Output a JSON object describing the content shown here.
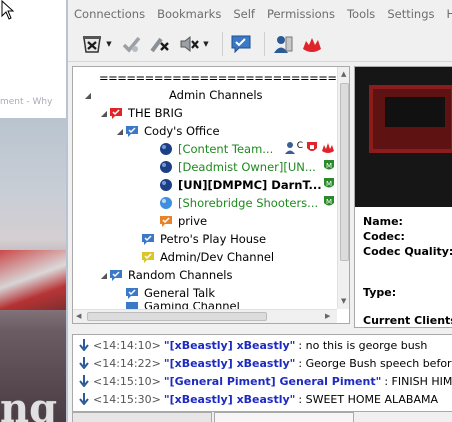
{
  "background_page": {
    "breadcrumb": "ment - Why",
    "photo_text": "ng"
  },
  "menubar": {
    "items": [
      "Connections",
      "Bookmarks",
      "Self",
      "Permissions",
      "Tools",
      "Settings",
      "H"
    ]
  },
  "toolbar": {
    "buttons": [
      "disconnect-icon",
      "away-icon",
      "mute-microphone-icon",
      "mute-speakers-icon",
      "chat-icon",
      "contacts-icon",
      "teamspeak-icon"
    ]
  },
  "tree": {
    "rows": [
      {
        "label": "==========================",
        "style": "normal"
      },
      {
        "label": "Admin Channels",
        "style": "normal"
      },
      {
        "label": "THE BRIG",
        "style": "normal"
      },
      {
        "label": "Cody's Office",
        "style": "normal"
      },
      {
        "label": "[Content Team...",
        "style": "green"
      },
      {
        "label": "[Deadmist Owner][UN...",
        "style": "green"
      },
      {
        "label": "[UN][DMPMC] DarnT...",
        "style": "bold"
      },
      {
        "label": "[Shorebridge Shooters...",
        "style": "green"
      },
      {
        "label": "prive",
        "style": "normal"
      },
      {
        "label": "Petro's Play House",
        "style": "normal"
      },
      {
        "label": "Admin/Dev Channel",
        "style": "normal"
      },
      {
        "label": "Random Channels",
        "style": "normal"
      },
      {
        "label": "General Talk",
        "style": "normal"
      },
      {
        "label": "Gaming Channel",
        "style": "normal"
      }
    ],
    "badge_c": "C",
    "badge_m": "M"
  },
  "info": {
    "name_label": "Name:",
    "codec_label": "Codec:",
    "codec_quality_label": "Codec Quality:",
    "type_label": "Type:",
    "current_clients_label": "Current Clients:"
  },
  "chat": {
    "lines": [
      {
        "time": "<14:14:10>",
        "nick": "\"[xBeastly] xBeastly\"",
        "message": ": no this is george bush"
      },
      {
        "time": "<14:14:22>",
        "nick": "\"[xBeastly] xBeastly\"",
        "message": ": George Bush speech before he pas"
      },
      {
        "time": "<14:15:10>",
        "nick": "\"[General Piment] General Piment\"",
        "message": ": FINISH HIM"
      },
      {
        "time": "<14:15:30>",
        "nick": "\"[xBeastly] xBeastly\"",
        "message": ": SWEET HOME ALABAMA"
      }
    ]
  },
  "colors": {
    "nick_blue": "#1d2ac0",
    "client_green": "#1f8a1f",
    "brand_red": "#e0252a"
  }
}
